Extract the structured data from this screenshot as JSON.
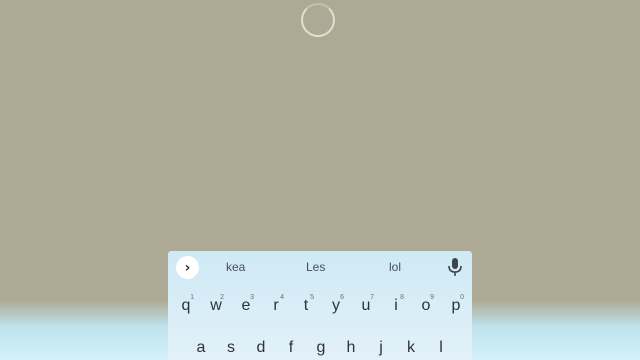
{
  "loading": {
    "icon": "loading-spinner-icon"
  },
  "keyboard": {
    "expand_icon": "chevron-right-icon",
    "expand_glyph": "›",
    "suggestions": [
      "kea",
      "Les",
      "lol"
    ],
    "mic_icon": "microphone-icon",
    "row1": [
      {
        "key": "q",
        "hint": "1"
      },
      {
        "key": "w",
        "hint": "2"
      },
      {
        "key": "e",
        "hint": "3"
      },
      {
        "key": "r",
        "hint": "4"
      },
      {
        "key": "t",
        "hint": "5"
      },
      {
        "key": "y",
        "hint": "6"
      },
      {
        "key": "u",
        "hint": "7"
      },
      {
        "key": "i",
        "hint": "8"
      },
      {
        "key": "o",
        "hint": "9"
      },
      {
        "key": "p",
        "hint": "0"
      }
    ],
    "row2": [
      "a",
      "s",
      "d",
      "f",
      "g",
      "h",
      "j",
      "k",
      "l"
    ]
  },
  "colors": {
    "background": "#aea994",
    "keyboard": "#d4ecf7",
    "key_text": "#2f3338"
  }
}
